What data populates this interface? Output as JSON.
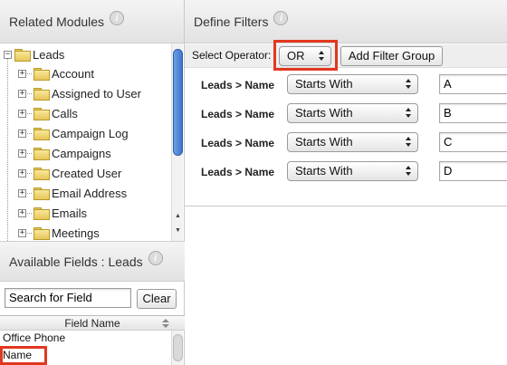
{
  "related_modules": {
    "title": "Related Modules",
    "info_icon": "info-icon",
    "root": {
      "label": "Leads",
      "expander": "−"
    },
    "items": [
      {
        "label": "Account",
        "expander": "+"
      },
      {
        "label": "Assigned to User",
        "expander": "+"
      },
      {
        "label": "Calls",
        "expander": "+"
      },
      {
        "label": "Campaign Log",
        "expander": "+"
      },
      {
        "label": "Campaigns",
        "expander": "+"
      },
      {
        "label": "Created User",
        "expander": "+"
      },
      {
        "label": "Email Address",
        "expander": "+"
      },
      {
        "label": "Emails",
        "expander": "+"
      },
      {
        "label": "Meetings",
        "expander": "+"
      }
    ]
  },
  "available_fields": {
    "title": "Available Fields : Leads",
    "search_value": "Search for Field",
    "clear_label": "Clear",
    "column_header": "Field Name",
    "rows": [
      "Office Phone",
      "Name"
    ]
  },
  "define_filters": {
    "title": "Define Filters",
    "operator_label": "Select Operator:",
    "operator_value": "OR",
    "add_group_label": "Add Filter Group",
    "filters": [
      {
        "field": "Leads > Name",
        "operator": "Starts With",
        "value": "A"
      },
      {
        "field": "Leads > Name",
        "operator": "Starts With",
        "value": "B"
      },
      {
        "field": "Leads > Name",
        "operator": "Starts With",
        "value": "C"
      },
      {
        "field": "Leads > Name",
        "operator": "Starts With",
        "value": "D"
      }
    ]
  },
  "colors": {
    "highlight": "#e2371f",
    "scroll_thumb": "#3f74cc"
  }
}
